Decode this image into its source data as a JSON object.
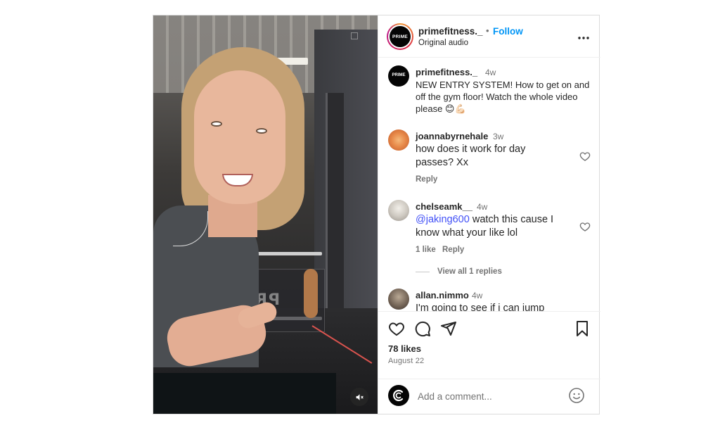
{
  "post": {
    "account": "primefitness._",
    "follow_label": "Follow",
    "separator": "•",
    "subtitle": "Original audio",
    "more_label": "•••",
    "avatar_logo": "PRIME",
    "media_reflection_text": "PRIME"
  },
  "caption": {
    "user": "primefitness._",
    "time": "4w",
    "text": "NEW ENTRY SYSTEM! How to get on and off the gym floor! Watch the whole video please 😊💪🏻"
  },
  "comments": [
    {
      "user": "joannabyrnehale",
      "time": "3w",
      "text": "how does it work for day passes? Xx",
      "reply_label": "Reply"
    },
    {
      "user": "chelseamk__",
      "time": "4w",
      "mention": "@jaking600",
      "text": " watch this cause I know what your like lol",
      "likes_label": "1 like",
      "reply_label": "Reply",
      "view_replies_label": "View all 1 replies"
    },
    {
      "user": "allan.nimmo",
      "time": "4w",
      "text": "I'm going to see if i can jump"
    }
  ],
  "footer": {
    "likes": "78 likes",
    "date": "August 22",
    "comment_placeholder": "Add a comment..."
  },
  "colors": {
    "link_blue": "#0095f6",
    "mention_blue": "#4150f7",
    "text": "#262626",
    "muted": "#737373",
    "border": "#dbdbdb"
  },
  "icons": {
    "header_more": "more-horizontal-icon",
    "like": "heart-icon",
    "comment": "comment-icon",
    "share": "share-icon",
    "save": "bookmark-icon",
    "mute": "speaker-muted-icon",
    "emoji": "emoji-icon"
  }
}
